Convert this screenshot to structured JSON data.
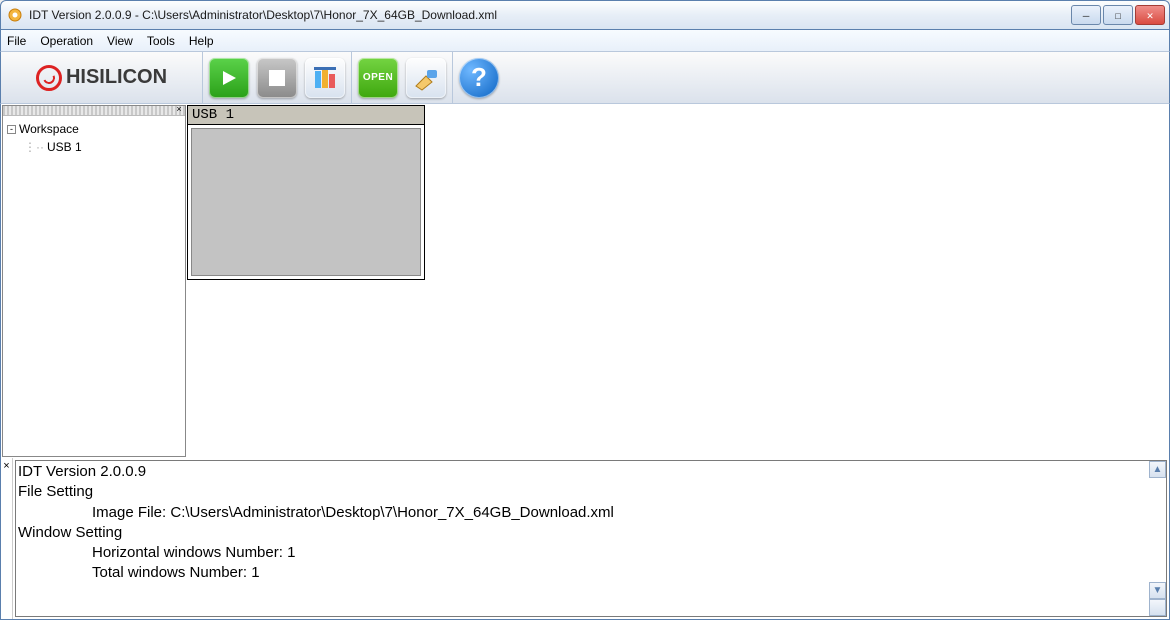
{
  "window": {
    "title": "IDT Version 2.0.0.9 - C:\\Users\\Administrator\\Desktop\\7\\Honor_7X_64GB_Download.xml"
  },
  "menu": {
    "file": "File",
    "operation": "Operation",
    "view": "View",
    "tools": "Tools",
    "help": "Help"
  },
  "logo": {
    "text": "HISILICON"
  },
  "toolbar": {
    "open_label": "OPEN",
    "help_glyph": "?"
  },
  "sidebar": {
    "root_label": "Workspace",
    "items": [
      {
        "label": "USB 1"
      }
    ]
  },
  "device_box": {
    "title": "USB 1"
  },
  "log": {
    "lines": [
      {
        "cls": "indent1",
        "text": "IDT Version 2.0.0.9"
      },
      {
        "cls": "indent1",
        "text": "File Setting"
      },
      {
        "cls": "indent2",
        "text": "Image File: C:\\Users\\Administrator\\Desktop\\7\\Honor_7X_64GB_Download.xml"
      },
      {
        "cls": "indent1",
        "text": "Window Setting"
      },
      {
        "cls": "indent2",
        "text": "Horizontal windows Number: 1"
      },
      {
        "cls": "indent2",
        "text": "Total windows Number: 1"
      }
    ]
  }
}
